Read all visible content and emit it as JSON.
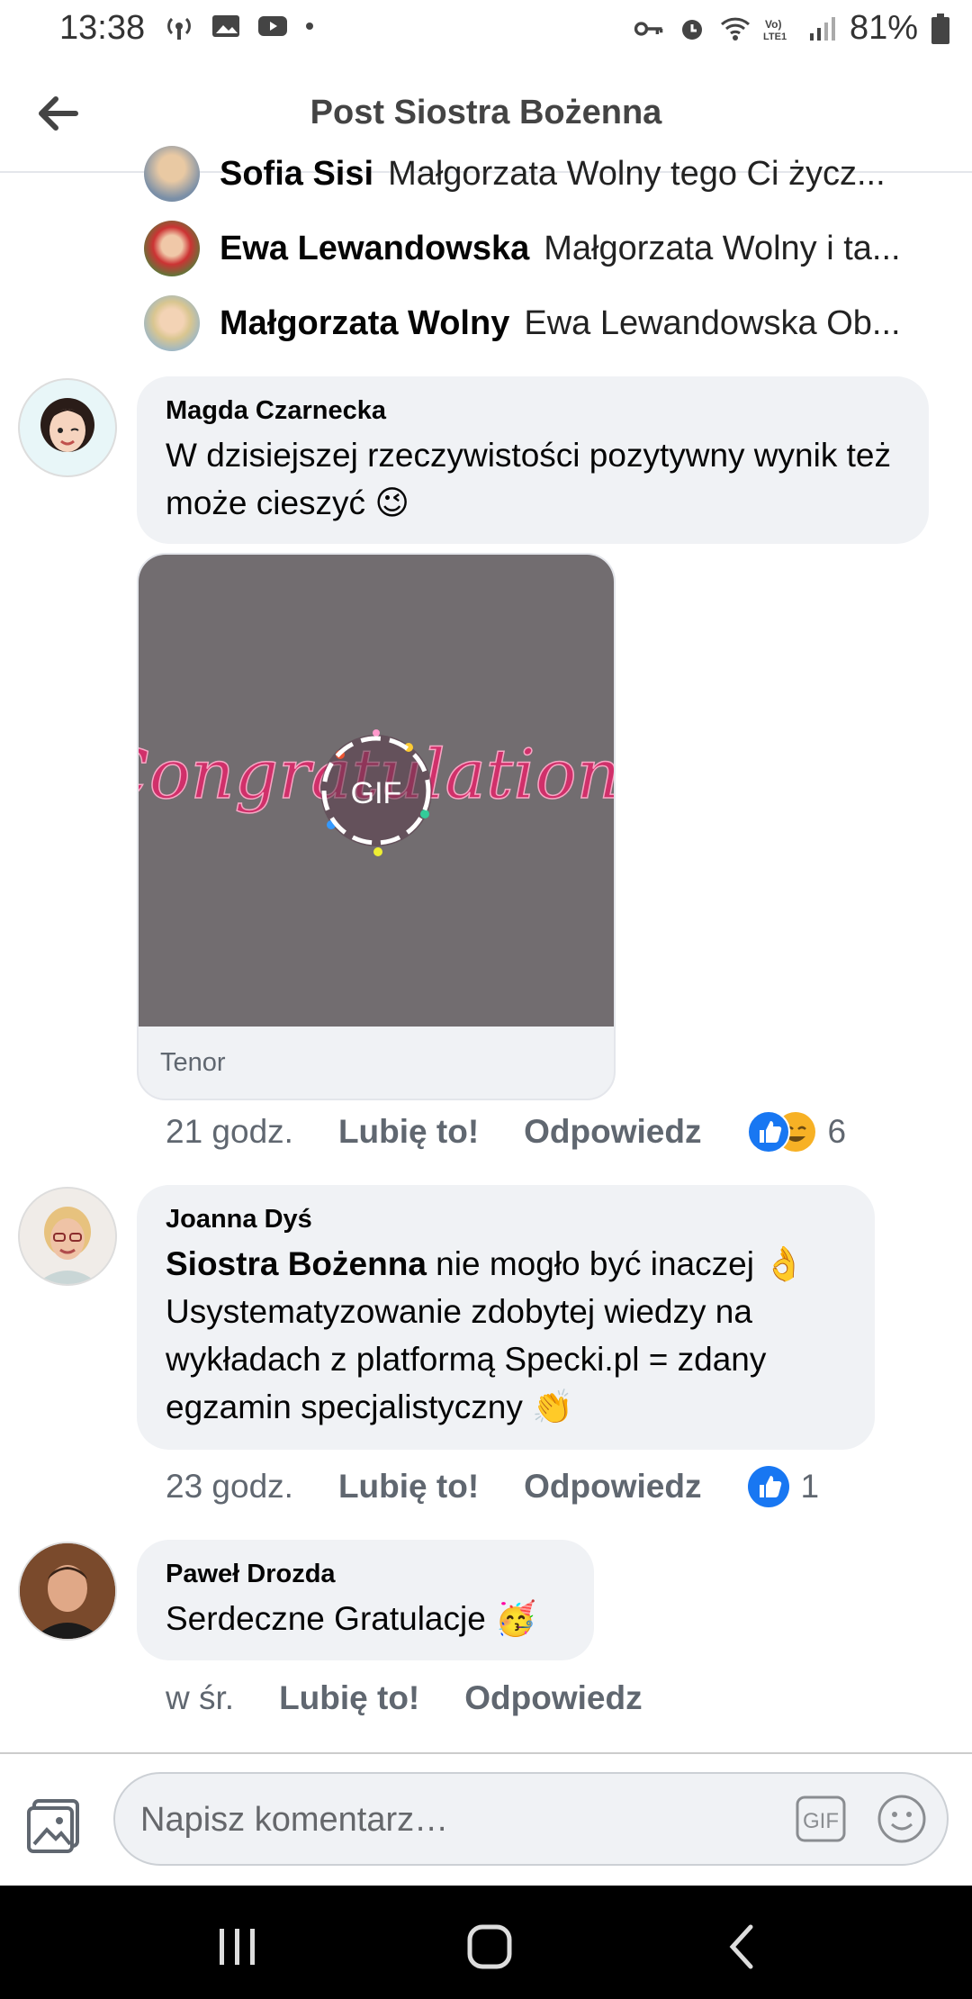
{
  "status_bar": {
    "time": "13:38",
    "battery": "81%",
    "icons_left": [
      "hotspot-icon",
      "image-icon",
      "youtube-icon",
      "dot-icon"
    ],
    "icons_right": [
      "key-icon",
      "alarm-icon",
      "wifi-icon",
      "volte-icon",
      "signal-icon",
      "battery-icon"
    ]
  },
  "header": {
    "title": "Post Siostra Bożenna"
  },
  "replies": [
    {
      "name": "Sofia Sisi",
      "text": "Małgorzata Wolny tego Ci życz..."
    },
    {
      "name": "Ewa Lewandowska",
      "text": "Małgorzata Wolny i ta..."
    },
    {
      "name": "Małgorzata Wolny",
      "text": "Ewa Lewandowska Ob..."
    }
  ],
  "comments": [
    {
      "author": "Magda Czarnecka",
      "text": "W dzisiejszej rzeczywistości pozytywny wynik też może cieszyć 😉",
      "gif_source": "Tenor",
      "gif_badge": "GIF",
      "gif_caption": "Congratulations",
      "time": "21 godz.",
      "like": "Lubię to!",
      "reply": "Odpowiedz",
      "reaction_count": "6"
    },
    {
      "author": "Joanna Dyś",
      "mention": "Siostra Bożenna",
      "text": " nie mogło być inaczej 👌 Usystematyzowanie zdobytej wiedzy na wykładach z platformą  Specki.pl = zdany egzamin specjalistyczny 👏",
      "time": "23 godz.",
      "like": "Lubię to!",
      "reply": "Odpowiedz",
      "reaction_count": "1"
    },
    {
      "author": "Paweł Drozda",
      "text": "Serdeczne Gratulacje 🥳",
      "time": "w śr.",
      "like": "Lubię to!",
      "reply": "Odpowiedz"
    }
  ],
  "composer": {
    "placeholder": "Napisz komentarz…",
    "gif_label": "GIF"
  },
  "colors": {
    "bubble": "#f0f2f5",
    "like_blue": "#1877f2",
    "meta_gray": "#606770",
    "gif_bg": "#726d70",
    "gif_text": "#d0306a"
  }
}
